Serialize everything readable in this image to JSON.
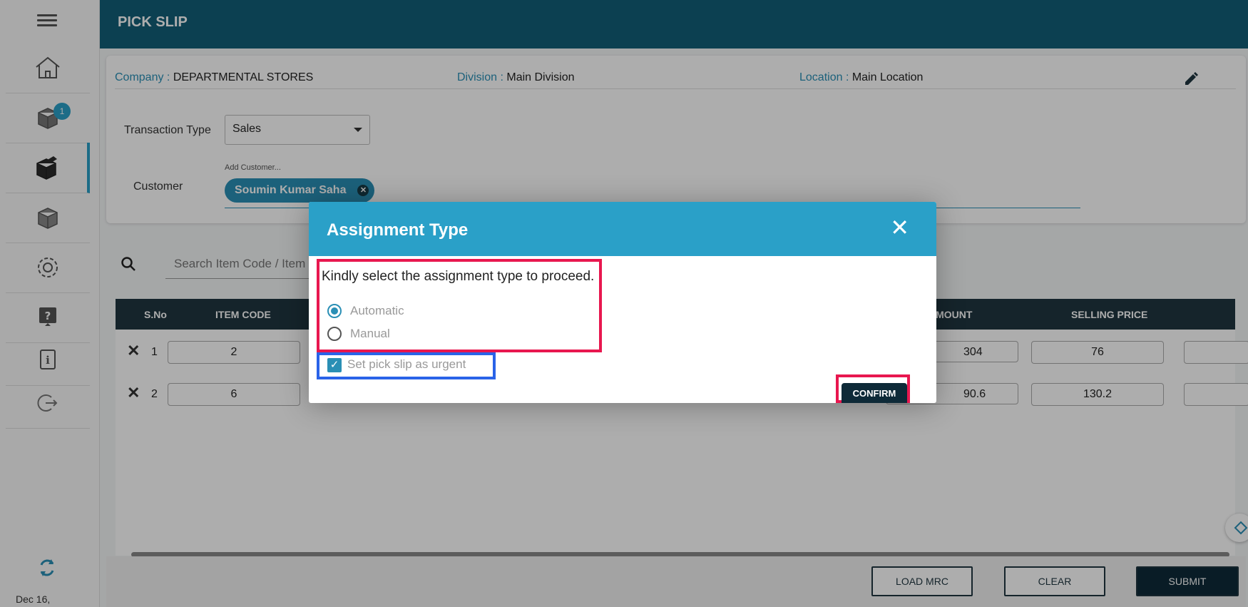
{
  "app": {
    "title": "PICK SLIP"
  },
  "sidebar": {
    "badge_count": "1",
    "date": "Dec 16,",
    "items": [
      {
        "icon": "home-icon"
      },
      {
        "icon": "box-badge-icon"
      },
      {
        "icon": "pick-slip-icon"
      },
      {
        "icon": "box-icon"
      },
      {
        "icon": "gear-icon"
      },
      {
        "icon": "help-icon"
      },
      {
        "icon": "info-icon"
      },
      {
        "icon": "logout-icon"
      }
    ]
  },
  "header_info": {
    "company_label": "Company : ",
    "company_value": "DEPARTMENTAL STORES",
    "division_label": "Division : ",
    "division_value": "Main Division",
    "location_label": "Location : ",
    "location_value": "Main Location"
  },
  "form": {
    "transaction_type_label": "Transaction Type",
    "transaction_type_value": "Sales",
    "customer_label": "Customer",
    "customer_placeholder": "Add Customer...",
    "customer_chip": "Soumin Kumar Saha"
  },
  "search": {
    "placeholder": "Search Item Code / Item"
  },
  "table": {
    "headers": {
      "sno": "S.No",
      "item_code": "ITEM CODE",
      "amount": "AMOUNT",
      "selling_price": "SELLING PRICE"
    },
    "rows": [
      {
        "sno": "1",
        "item_code": "2",
        "amount": "304",
        "selling_price": "76"
      },
      {
        "sno": "2",
        "item_code": "6",
        "amount": "90.6",
        "selling_price": "130.2"
      }
    ]
  },
  "footer": {
    "load_mrc": "LOAD MRC",
    "clear": "CLEAR",
    "submit": "SUBMIT"
  },
  "modal": {
    "title": "Assignment Type",
    "prompt": "Kindly select the assignment type to proceed.",
    "options": [
      {
        "label": "Automatic",
        "selected": true
      },
      {
        "label": "Manual",
        "selected": false
      }
    ],
    "urgent_label": "Set pick slip as urgent",
    "urgent_checked": true,
    "confirm_label": "CONFIRM"
  },
  "colors": {
    "accent": "#2aa0c8",
    "header": "#125f78",
    "dark": "#0e2a38",
    "highlight_red": "#e8174f",
    "highlight_blue": "#2a63e8"
  }
}
